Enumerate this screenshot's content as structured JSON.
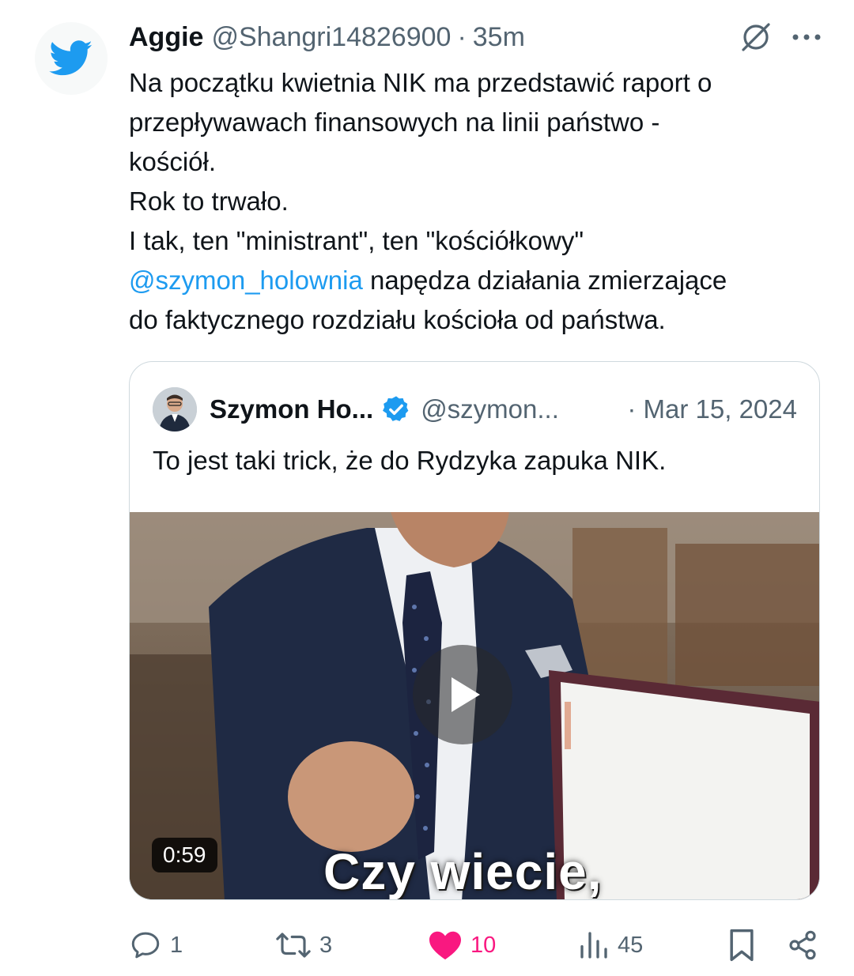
{
  "tweet": {
    "author_name": "Aggie",
    "author_handle": "@Shangri14826900",
    "separator": "·",
    "time": "35m",
    "text_part1": "Na początku kwietnia NIK ma przedstawić raport o\nprzepływawach finansowych na linii państwo -\nkościół.\nRok to trwało.\nI tak, ten \"ministrant\", ten \"kościółkowy\"\n",
    "mention": "@szymon_holownia",
    "text_part2": " napędza działania zmierzające\ndo faktycznego rozdziału kościoła od państwa."
  },
  "quote": {
    "author_name": "Szymon Ho...",
    "author_handle": "@szymon...",
    "date": "· Mar 15, 2024",
    "text": "To jest taki trick, że do Rydzyka zapuka NIK.",
    "video_duration": "0:59",
    "video_caption": "Czy wiecie,"
  },
  "actions": {
    "replies": "1",
    "reposts": "3",
    "likes": "10",
    "views": "45"
  },
  "icons": {
    "brand": "twitter-bird-icon",
    "grok": "grok-icon",
    "more": "more-icon",
    "verified": "verified-badge-icon",
    "reply": "reply-icon",
    "repost": "repost-icon",
    "like": "heart-icon",
    "views": "views-icon",
    "bookmark": "bookmark-icon",
    "share": "share-icon"
  },
  "colors": {
    "brand": "#1d9bf0",
    "like": "#f91880",
    "secondary_text": "#536471"
  }
}
